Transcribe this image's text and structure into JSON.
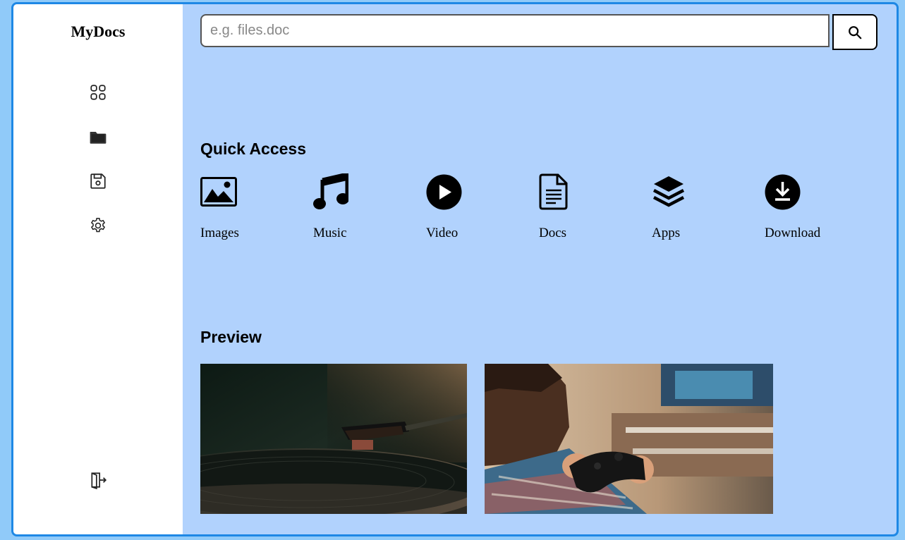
{
  "app": {
    "title": "MyDocs"
  },
  "sidebar": {
    "items": [
      {
        "name": "dashboard",
        "icon": "grid-icon"
      },
      {
        "name": "folders",
        "icon": "folder-icon"
      },
      {
        "name": "saved",
        "icon": "save-icon"
      },
      {
        "name": "settings",
        "icon": "gear-icon"
      }
    ],
    "logout": {
      "icon": "logout-icon"
    }
  },
  "search": {
    "placeholder": "e.g. files.doc",
    "value": "",
    "button_icon": "search-icon"
  },
  "quick_access": {
    "title": "Quick Access",
    "items": [
      {
        "label": "Images",
        "icon": "image-icon"
      },
      {
        "label": "Music",
        "icon": "music-icon"
      },
      {
        "label": "Video",
        "icon": "play-icon"
      },
      {
        "label": "Docs",
        "icon": "document-icon"
      },
      {
        "label": "Apps",
        "icon": "layers-icon"
      },
      {
        "label": "Download",
        "icon": "download-icon"
      }
    ]
  },
  "preview": {
    "title": "Preview",
    "items": [
      {
        "name": "turntable-photo"
      },
      {
        "name": "gamer-photo"
      }
    ]
  },
  "colors": {
    "page_background": "#90caf9",
    "frame_border": "#1e88e5",
    "main_background": "#b1d2fd",
    "sidebar_background": "#ffffff"
  }
}
